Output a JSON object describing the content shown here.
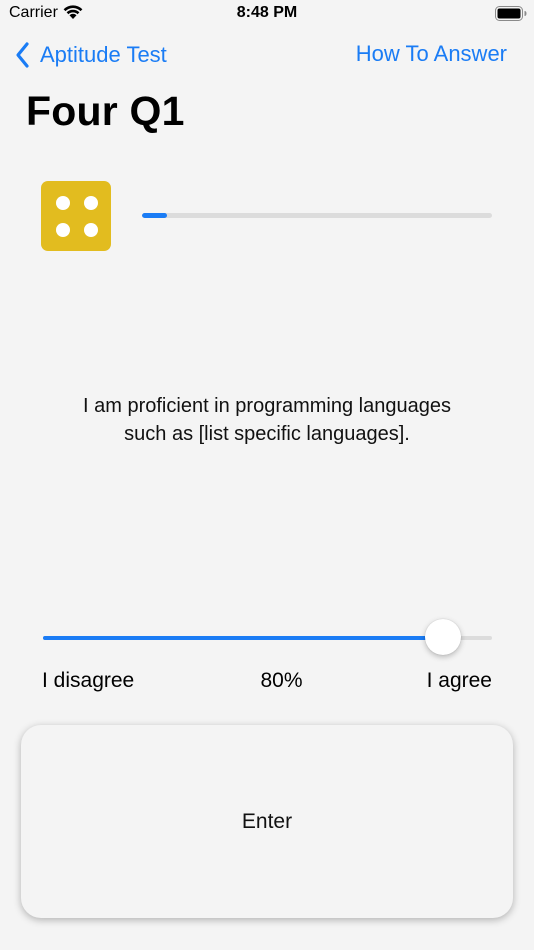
{
  "status_bar": {
    "carrier": "Carrier",
    "time": "8:48 PM",
    "icons": [
      "wifi-icon",
      "battery-icon"
    ]
  },
  "nav": {
    "back_label": "Aptitude Test",
    "back_icon": "chevron-left-icon",
    "right_label": "How To Answer"
  },
  "page_title": "Four Q1",
  "dice": {
    "icon": "dice-four-icon",
    "face_value": 4,
    "color": "#e2bc1f"
  },
  "progress": {
    "fraction": 0.07,
    "color": "#1a7cf5"
  },
  "question": {
    "text": "I am proficient in programming languages such as [list specific languages]."
  },
  "slider": {
    "value": 0.89,
    "min_label": "I disagree",
    "value_label": "80%",
    "max_label": "I agree",
    "accent": "#1a7cf5"
  },
  "enter_button": {
    "label": "Enter"
  }
}
